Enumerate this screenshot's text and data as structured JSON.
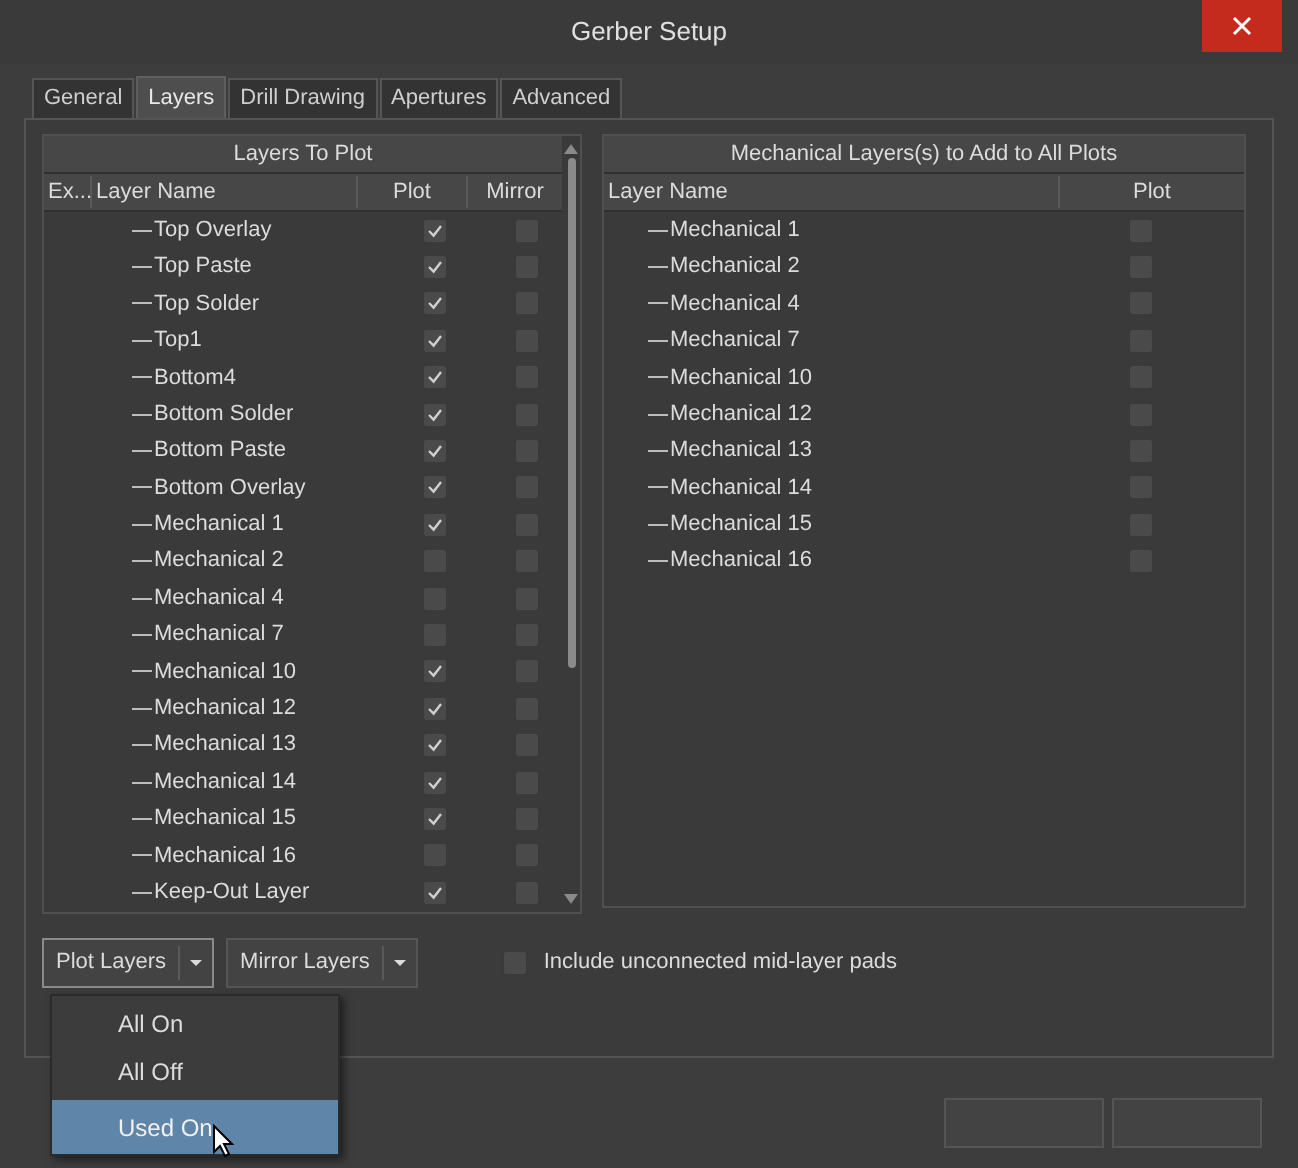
{
  "window": {
    "title": "Gerber Setup"
  },
  "tabs": [
    {
      "label": "General",
      "selected": false
    },
    {
      "label": "Layers",
      "selected": true
    },
    {
      "label": "Drill Drawing",
      "selected": false
    },
    {
      "label": "Apertures",
      "selected": false
    },
    {
      "label": "Advanced",
      "selected": false
    }
  ],
  "layers_table": {
    "title": "Layers To Plot",
    "columns": [
      "Ex...",
      "Layer Name",
      "Plot",
      "Mirror"
    ],
    "rows": [
      {
        "name": "Top Overlay",
        "plot": true,
        "mirror": false
      },
      {
        "name": "Top Paste",
        "plot": true,
        "mirror": false
      },
      {
        "name": "Top Solder",
        "plot": true,
        "mirror": false
      },
      {
        "name": "Top1",
        "plot": true,
        "mirror": false
      },
      {
        "name": "Bottom4",
        "plot": true,
        "mirror": false
      },
      {
        "name": "Bottom Solder",
        "plot": true,
        "mirror": false
      },
      {
        "name": "Bottom Paste",
        "plot": true,
        "mirror": false
      },
      {
        "name": "Bottom Overlay",
        "plot": true,
        "mirror": false
      },
      {
        "name": "Mechanical 1",
        "plot": true,
        "mirror": false
      },
      {
        "name": "Mechanical 2",
        "plot": false,
        "mirror": false
      },
      {
        "name": "Mechanical 4",
        "plot": false,
        "mirror": false
      },
      {
        "name": "Mechanical 7",
        "plot": false,
        "mirror": false
      },
      {
        "name": "Mechanical 10",
        "plot": true,
        "mirror": false
      },
      {
        "name": "Mechanical 12",
        "plot": true,
        "mirror": false
      },
      {
        "name": "Mechanical 13",
        "plot": true,
        "mirror": false
      },
      {
        "name": "Mechanical 14",
        "plot": true,
        "mirror": false
      },
      {
        "name": "Mechanical 15",
        "plot": true,
        "mirror": false
      },
      {
        "name": "Mechanical 16",
        "plot": false,
        "mirror": false
      },
      {
        "name": "Keep-Out Layer",
        "plot": true,
        "mirror": false
      }
    ]
  },
  "mech_table": {
    "title": "Mechanical Layers(s) to Add to All Plots",
    "columns": [
      "Layer Name",
      "Plot"
    ],
    "rows": [
      {
        "name": "Mechanical 1",
        "plot": false
      },
      {
        "name": "Mechanical 2",
        "plot": false
      },
      {
        "name": "Mechanical 4",
        "plot": false
      },
      {
        "name": "Mechanical 7",
        "plot": false
      },
      {
        "name": "Mechanical 10",
        "plot": false
      },
      {
        "name": "Mechanical 12",
        "plot": false
      },
      {
        "name": "Mechanical 13",
        "plot": false
      },
      {
        "name": "Mechanical 14",
        "plot": false
      },
      {
        "name": "Mechanical 15",
        "plot": false
      },
      {
        "name": "Mechanical 16",
        "plot": false
      }
    ]
  },
  "buttons": [
    {
      "label": "Plot Layers"
    },
    {
      "label": "Mirror Layers"
    }
  ],
  "include_pads": {
    "label": "Include unconnected mid-layer pads",
    "checked": false
  },
  "menu": [
    {
      "label": "All On",
      "selected": false
    },
    {
      "label": "All Off",
      "selected": false
    },
    {
      "label": "Used On",
      "selected": true
    }
  ]
}
